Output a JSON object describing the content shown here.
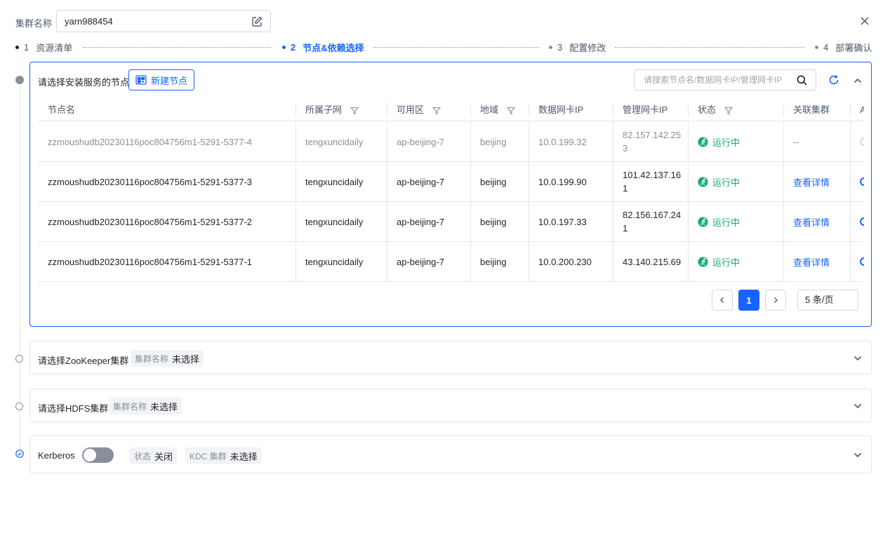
{
  "header": {
    "cluster_label": "集群名称",
    "cluster_name": "yarn988454"
  },
  "steps": [
    {
      "num": "1",
      "label": "资源清单",
      "state": "done"
    },
    {
      "num": "2",
      "label": "节点&依赖选择",
      "state": "active"
    },
    {
      "num": "3",
      "label": "配置修改",
      "state": "todo"
    },
    {
      "num": "4",
      "label": "部署确认",
      "state": "todo"
    }
  ],
  "nodes_panel": {
    "title": "请选择安装服务的节点",
    "new_node_label": "新建节点",
    "search_placeholder": "请搜索节点名/数据网卡IP/管理网卡IP",
    "columns": [
      "节点名",
      "所属子网",
      "可用区",
      "地域",
      "数据网卡IP",
      "管理网卡IP",
      "状态",
      "关联集群",
      "A"
    ],
    "rows": [
      {
        "name": "zzmoushudb20230116poc804756m1-5291-5377-4",
        "subnet": "tengxuncidaily",
        "zone": "ap-beijing-7",
        "region": "beijing",
        "data_ip": "10.0.199.32",
        "mgmt_ip": "82.157.142.253",
        "status": "运行中",
        "cluster": "--",
        "disabled": true
      },
      {
        "name": "zzmoushudb20230116poc804756m1-5291-5377-3",
        "subnet": "tengxuncidaily",
        "zone": "ap-beijing-7",
        "region": "beijing",
        "data_ip": "10.0.199.90",
        "mgmt_ip": "101.42.137.161",
        "status": "运行中",
        "cluster": "查看详情",
        "disabled": false
      },
      {
        "name": "zzmoushudb20230116poc804756m1-5291-5377-2",
        "subnet": "tengxuncidaily",
        "zone": "ap-beijing-7",
        "region": "beijing",
        "data_ip": "10.0.197.33",
        "mgmt_ip": "82.156.167.241",
        "status": "运行中",
        "cluster": "查看详情",
        "disabled": false
      },
      {
        "name": "zzmoushudb20230116poc804756m1-5291-5377-1",
        "subnet": "tengxuncidaily",
        "zone": "ap-beijing-7",
        "region": "beijing",
        "data_ip": "10.0.200.230",
        "mgmt_ip": "43.140.215.69",
        "status": "运行中",
        "cluster": "查看详情",
        "disabled": false
      }
    ],
    "pagination": {
      "current_page": "1",
      "page_size": "5 条/页"
    }
  },
  "zookeeper_panel": {
    "title": "请选择ZooKeeper集群",
    "tag_key": "集群名称",
    "tag_value": "未选择"
  },
  "hdfs_panel": {
    "title": "请选择HDFS集群",
    "tag_key": "集群名称",
    "tag_value": "未选择"
  },
  "kerberos_panel": {
    "title": "Kerberos",
    "toggle_on": false,
    "status_key": "状态",
    "status_value": "关闭",
    "kdc_key": "KDC 集群",
    "kdc_value": "未选择"
  },
  "colors": {
    "primary": "#1664ff",
    "success": "#15a675",
    "border": "#e5e6eb",
    "muted": "#86909c"
  }
}
